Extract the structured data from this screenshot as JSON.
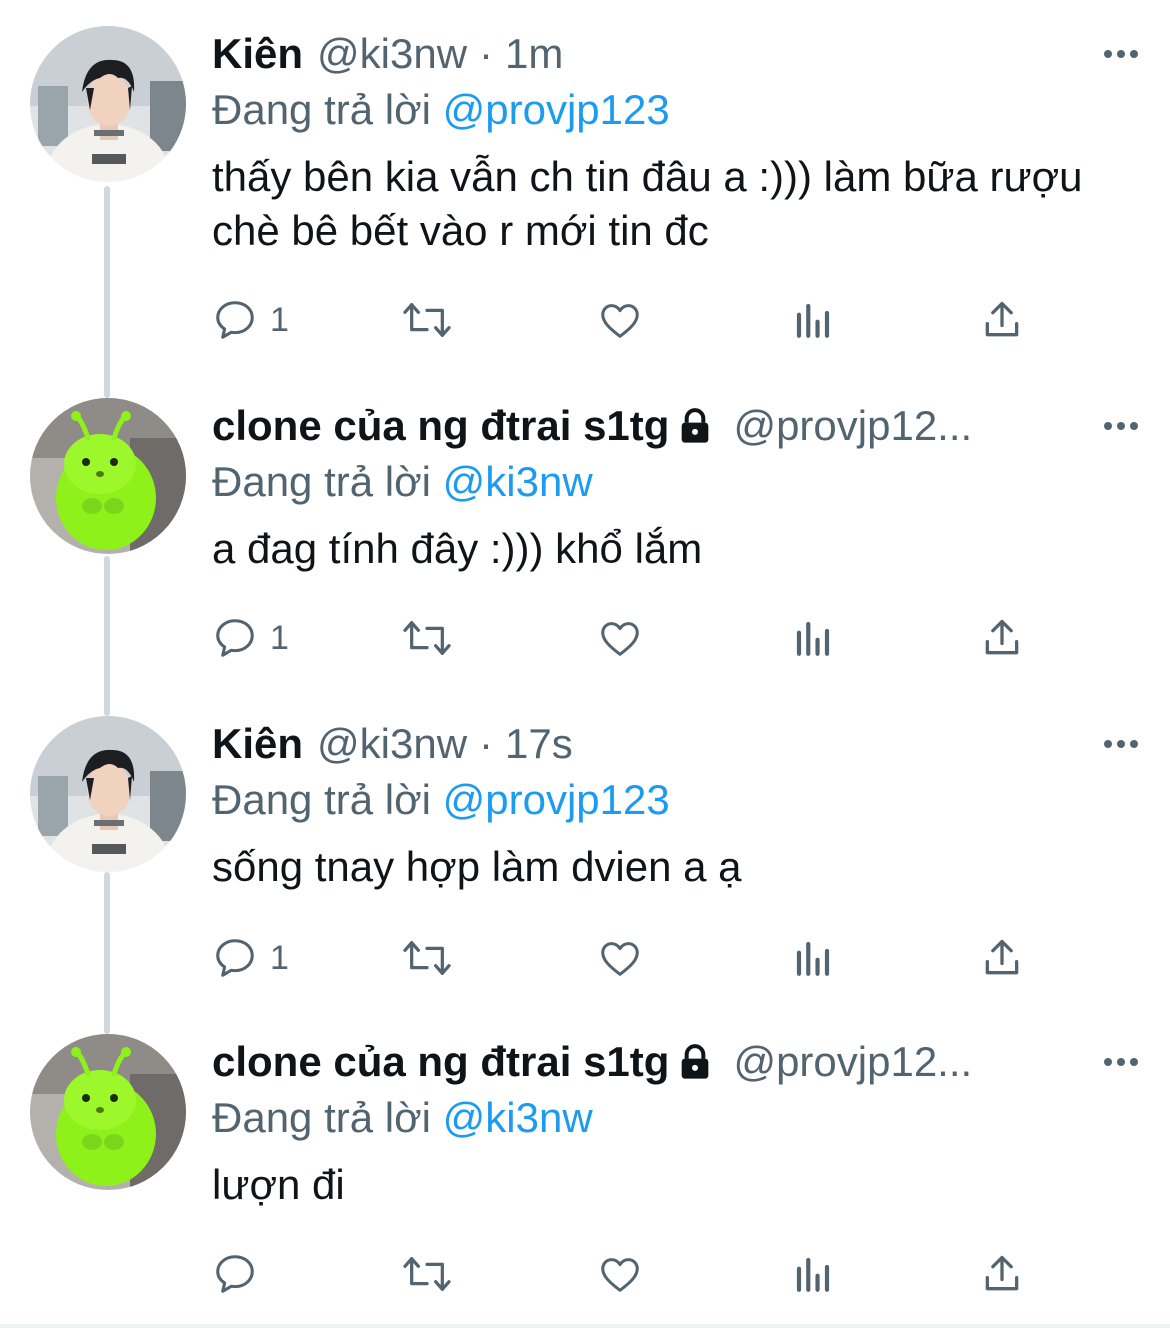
{
  "tweets": [
    {
      "display_name": "Kiên",
      "handle": "@ki3nw",
      "separator": "·",
      "time": "1m",
      "protected": false,
      "avatar": "person-avatar",
      "reply_prefix": "Đang trả lời",
      "reply_to": "@provjp123",
      "text": "thấy bên kia vẫn ch tin đâu a :))) làm bữa rượu chè bê bết vào r mới tin đc",
      "reply_count": "1",
      "retweet_count": "",
      "like_count": ""
    },
    {
      "display_name": "clone của ng đtrai s1tg",
      "handle": "@provjp12...",
      "separator": "",
      "time": "",
      "protected": true,
      "avatar": "green-hamster-avatar",
      "reply_prefix": "Đang trả lời",
      "reply_to": "@ki3nw",
      "text": "a đag tính đây :))) khổ lắm",
      "reply_count": "1",
      "retweet_count": "",
      "like_count": ""
    },
    {
      "display_name": "Kiên",
      "handle": "@ki3nw",
      "separator": "·",
      "time": "17s",
      "protected": false,
      "avatar": "person-avatar",
      "reply_prefix": "Đang trả lời",
      "reply_to": "@provjp123",
      "text": "sống tnay hợp làm dvien a ạ",
      "reply_count": "1",
      "retweet_count": "",
      "like_count": ""
    },
    {
      "display_name": "clone của ng đtrai s1tg",
      "handle": "@provjp12...",
      "separator": "",
      "time": "",
      "protected": true,
      "avatar": "green-hamster-avatar",
      "reply_prefix": "Đang trả lời",
      "reply_to": "@ki3nw",
      "text": "lượn đi",
      "reply_count": "",
      "retweet_count": "",
      "like_count": ""
    }
  ],
  "icons": {
    "reply": "reply-bubble-icon",
    "retweet": "retweet-icon",
    "like": "heart-icon",
    "views": "analytics-icon",
    "share": "share-upload-icon",
    "more": "more-dots-icon",
    "lock": "lock-icon"
  },
  "colors": {
    "text_primary": "#0f1419",
    "text_secondary": "#536471",
    "mention_blue": "#1d9bf0",
    "thread_line": "#cfd9de",
    "avatar_green": "#8ef21a"
  }
}
